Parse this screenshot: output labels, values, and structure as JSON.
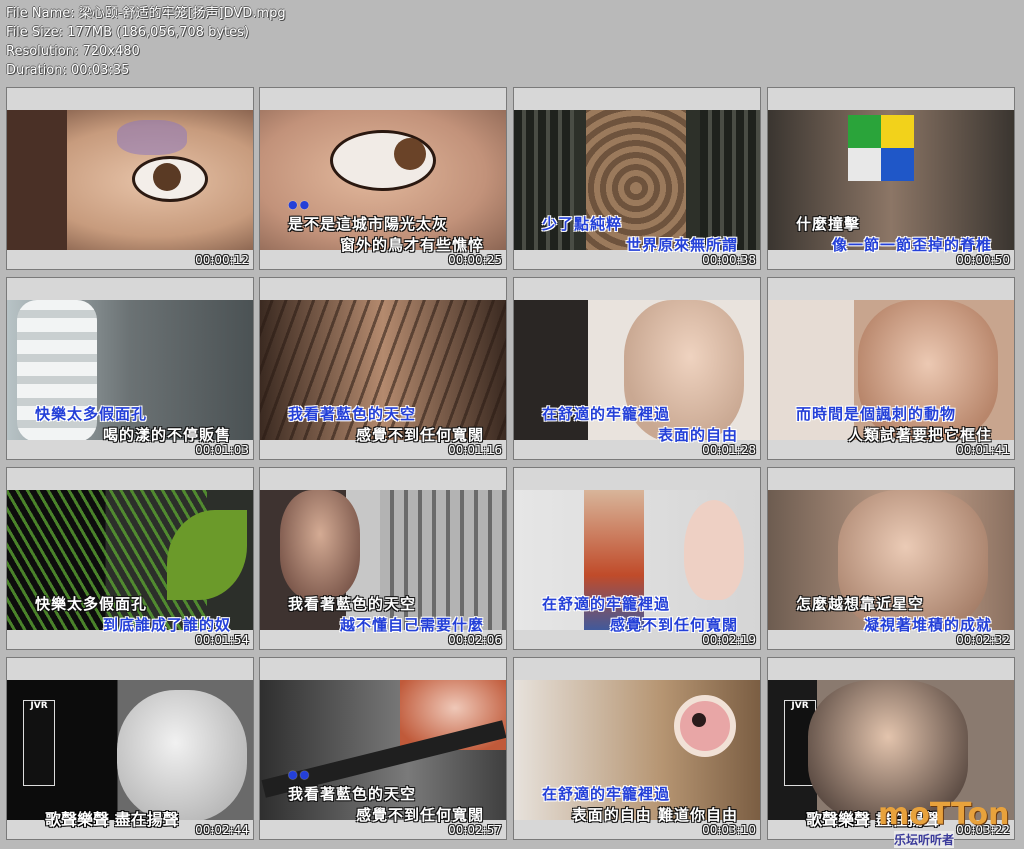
{
  "header": {
    "file_name": "File Name: 梁心颐-舒适的牢笼[扬声]DVD.mpg",
    "file_size": "File Size: 177MB (186,056,708 bytes)",
    "resolution": "Resolution: 720x480",
    "duration": "Duration: 00:03:35"
  },
  "thumbs": [
    {
      "ts": "00:00:12",
      "l1": "",
      "l2": ""
    },
    {
      "ts": "00:00:25",
      "l1": "是不是這城市陽光太灰",
      "l2": "窗外的鳥才有些憔悴"
    },
    {
      "ts": "00:00:38",
      "l1": "少了點純粹",
      "l2": "世界原來無所謂"
    },
    {
      "ts": "00:00:50",
      "l1": "什麼撞擊",
      "l2": "像一節一節歪掉的脊椎"
    },
    {
      "ts": "00:01:03",
      "l1": "快樂太多假面孔",
      "l2": "喝的漾的不停販售"
    },
    {
      "ts": "00:01:16",
      "l1": "我看著藍色的天空",
      "l2": "感覺不到任何寬闊"
    },
    {
      "ts": "00:01:28",
      "l1": "在舒適的牢籠裡過",
      "l2": "表面的自由"
    },
    {
      "ts": "00:01:41",
      "l1": "而時間是個諷刺的動物",
      "l2": "人類試著要把它框住"
    },
    {
      "ts": "00:01:54",
      "l1": "快樂太多假面孔",
      "l2": "到底誰成了誰的奴"
    },
    {
      "ts": "00:02:06",
      "l1": "我看著藍色的天空",
      "l2": "越不懂自己需要什麼"
    },
    {
      "ts": "00:02:19",
      "l1": "在舒適的牢籠裡過",
      "l2": "感覺不到任何寬闊"
    },
    {
      "ts": "00:02:32",
      "l1": "怎麼越想靠近星空",
      "l2": "凝視著堆積的成就"
    },
    {
      "ts": "00:02:44",
      "l1": "",
      "l2": "歌聲樂聲 盡在揚聲"
    },
    {
      "ts": "00:02:57",
      "l1": "我看著藍色的天空",
      "l2": "感覺不到任何寬闊"
    },
    {
      "ts": "00:03:10",
      "l1": "在舒適的牢籠裡過",
      "l2": "表面的自由 難道你自由"
    },
    {
      "ts": "00:03:22",
      "l1": "",
      "l2": "歌聲樂聲 盡在揚聲"
    }
  ],
  "watermark": {
    "main": "moTTon",
    "sub": "乐坛听听者"
  },
  "colors": {
    "background": "#b9b9b9",
    "subtitle_highlight": "#2440d8"
  }
}
